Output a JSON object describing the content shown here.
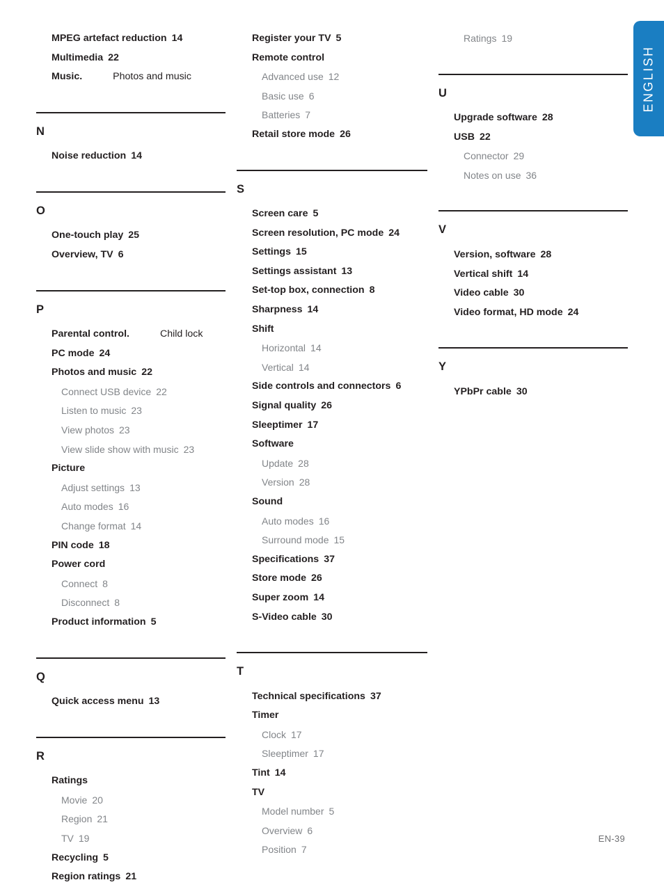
{
  "page": {
    "footer": "EN-39",
    "side_tab_label": "ENGLISH",
    "accent_color": "#1a7ec2",
    "text_color": "#231f20",
    "subentry_color": "#828589"
  },
  "columns": [
    {
      "id": "col-1",
      "groups": [
        {
          "letter": "",
          "rule": false,
          "entries": [
            {
              "level": 1,
              "label": "MPEG artefact reduction",
              "page": "14"
            },
            {
              "level": 1,
              "label": "Multimedia",
              "page": "22"
            },
            {
              "level": 1,
              "label": "Music.",
              "page": "",
              "xref": "Photos and music"
            }
          ]
        },
        {
          "letter": "N",
          "rule": true,
          "entries": [
            {
              "level": 1,
              "label": "Noise reduction",
              "page": "14"
            }
          ]
        },
        {
          "letter": "O",
          "rule": true,
          "entries": [
            {
              "level": 1,
              "label": "One-touch play",
              "page": "25"
            },
            {
              "level": 1,
              "label": "Overview, TV",
              "page": "6"
            }
          ]
        },
        {
          "letter": "P",
          "rule": true,
          "entries": [
            {
              "level": 1,
              "label": "Parental control.",
              "page": "",
              "xref": "Child lock"
            },
            {
              "level": 1,
              "label": "PC mode",
              "page": "24"
            },
            {
              "level": 1,
              "label": "Photos and music",
              "page": "22"
            },
            {
              "level": 2,
              "label": "Connect USB device",
              "page": "22"
            },
            {
              "level": 2,
              "label": "Listen to music",
              "page": "23"
            },
            {
              "level": 2,
              "label": "View photos",
              "page": "23"
            },
            {
              "level": 2,
              "label": "View slide show with music",
              "page": "23"
            },
            {
              "level": 1,
              "label": "Picture",
              "page": ""
            },
            {
              "level": 2,
              "label": "Adjust settings",
              "page": "13"
            },
            {
              "level": 2,
              "label": "Auto modes",
              "page": "16"
            },
            {
              "level": 2,
              "label": "Change format",
              "page": "14"
            },
            {
              "level": 1,
              "label": "PIN code",
              "page": "18"
            },
            {
              "level": 1,
              "label": "Power cord",
              "page": ""
            },
            {
              "level": 2,
              "label": "Connect",
              "page": "8"
            },
            {
              "level": 2,
              "label": "Disconnect",
              "page": "8"
            },
            {
              "level": 1,
              "label": "Product information",
              "page": "5"
            }
          ]
        },
        {
          "letter": "Q",
          "rule": true,
          "entries": [
            {
              "level": 1,
              "label": "Quick access menu",
              "page": "13"
            }
          ]
        },
        {
          "letter": "R",
          "rule": true,
          "entries": [
            {
              "level": 1,
              "label": "Ratings",
              "page": ""
            },
            {
              "level": 2,
              "label": "Movie",
              "page": "20"
            },
            {
              "level": 2,
              "label": "Region",
              "page": "21"
            },
            {
              "level": 2,
              "label": "TV",
              "page": "19"
            },
            {
              "level": 1,
              "label": "Recycling",
              "page": "5"
            },
            {
              "level": 1,
              "label": "Region ratings",
              "page": "21"
            }
          ]
        }
      ]
    },
    {
      "id": "col-2",
      "groups": [
        {
          "letter": "",
          "rule": false,
          "entries": [
            {
              "level": 1,
              "label": "Register your TV",
              "page": "5"
            },
            {
              "level": 1,
              "label": "Remote control",
              "page": ""
            },
            {
              "level": 2,
              "label": "Advanced use",
              "page": "12"
            },
            {
              "level": 2,
              "label": "Basic use",
              "page": "6"
            },
            {
              "level": 2,
              "label": "Batteries",
              "page": "7"
            },
            {
              "level": 1,
              "label": "Retail store mode",
              "page": "26"
            }
          ]
        },
        {
          "letter": "S",
          "rule": true,
          "entries": [
            {
              "level": 1,
              "label": "Screen care",
              "page": "5"
            },
            {
              "level": 1,
              "label": "Screen resolution, PC mode",
              "page": "24"
            },
            {
              "level": 1,
              "label": "Settings",
              "page": "15"
            },
            {
              "level": 1,
              "label": "Settings assistant",
              "page": "13"
            },
            {
              "level": 1,
              "label": "Set-top box, connection",
              "page": "8"
            },
            {
              "level": 1,
              "label": "Sharpness",
              "page": "14"
            },
            {
              "level": 1,
              "label": "Shift",
              "page": ""
            },
            {
              "level": 2,
              "label": "Horizontal",
              "page": "14"
            },
            {
              "level": 2,
              "label": "Vertical",
              "page": "14"
            },
            {
              "level": 1,
              "label": "Side controls and connectors",
              "page": "6"
            },
            {
              "level": 1,
              "label": "Signal quality",
              "page": "26"
            },
            {
              "level": 1,
              "label": "Sleeptimer",
              "page": "17"
            },
            {
              "level": 1,
              "label": "Software",
              "page": ""
            },
            {
              "level": 2,
              "label": "Update",
              "page": "28"
            },
            {
              "level": 2,
              "label": "Version",
              "page": "28"
            },
            {
              "level": 1,
              "label": "Sound",
              "page": ""
            },
            {
              "level": 2,
              "label": "Auto modes",
              "page": "16"
            },
            {
              "level": 2,
              "label": "Surround mode",
              "page": "15"
            },
            {
              "level": 1,
              "label": "Specifications",
              "page": "37"
            },
            {
              "level": 1,
              "label": "Store mode",
              "page": "26"
            },
            {
              "level": 1,
              "label": "Super zoom",
              "page": "14"
            },
            {
              "level": 1,
              "label": "S-Video cable",
              "page": "30"
            }
          ]
        },
        {
          "letter": "T",
          "rule": true,
          "entries": [
            {
              "level": 1,
              "label": "Technical specifications",
              "page": "37"
            },
            {
              "level": 1,
              "label": "Timer",
              "page": ""
            },
            {
              "level": 2,
              "label": "Clock",
              "page": "17"
            },
            {
              "level": 2,
              "label": "Sleeptimer",
              "page": "17"
            },
            {
              "level": 1,
              "label": "Tint",
              "page": "14"
            },
            {
              "level": 1,
              "label": "TV",
              "page": ""
            },
            {
              "level": 2,
              "label": "Model number",
              "page": "5"
            },
            {
              "level": 2,
              "label": "Overview",
              "page": "6"
            },
            {
              "level": 2,
              "label": "Position",
              "page": "7"
            }
          ]
        }
      ]
    },
    {
      "id": "col-3",
      "groups": [
        {
          "letter": "",
          "rule": false,
          "entries": [
            {
              "level": 2,
              "label": "Ratings",
              "page": "19"
            }
          ]
        },
        {
          "letter": "U",
          "rule": true,
          "entries": [
            {
              "level": 1,
              "label": "Upgrade software",
              "page": "28"
            },
            {
              "level": 1,
              "label": "USB",
              "page": "22"
            },
            {
              "level": 2,
              "label": "Connector",
              "page": "29"
            },
            {
              "level": 2,
              "label": "Notes on use",
              "page": "36"
            }
          ]
        },
        {
          "letter": "V",
          "rule": true,
          "entries": [
            {
              "level": 1,
              "label": "Version, software",
              "page": "28"
            },
            {
              "level": 1,
              "label": "Vertical shift",
              "page": "14"
            },
            {
              "level": 1,
              "label": "Video cable",
              "page": "30"
            },
            {
              "level": 1,
              "label": "Video format, HD mode",
              "page": "24"
            }
          ]
        },
        {
          "letter": "Y",
          "rule": true,
          "entries": [
            {
              "level": 1,
              "label": "YPbPr cable",
              "page": "30"
            }
          ]
        }
      ]
    }
  ]
}
